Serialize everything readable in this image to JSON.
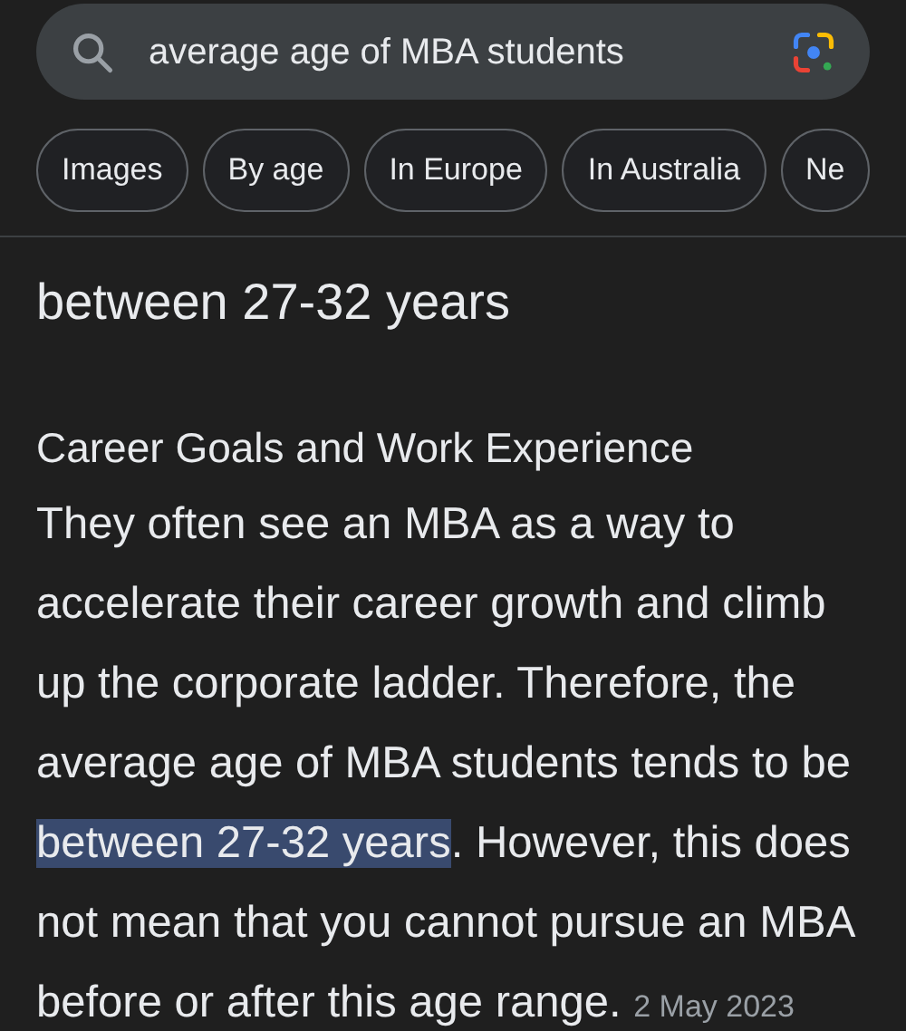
{
  "search": {
    "value": "average age of MBA students"
  },
  "chips": [
    {
      "label": "Images"
    },
    {
      "label": "By age"
    },
    {
      "label": "In Europe"
    },
    {
      "label": "In Australia"
    },
    {
      "label": "Ne"
    }
  ],
  "answer": "between 27-32 years",
  "section_heading": "Career Goals and Work Experience",
  "snippet": "They often see an MBA as a way to accelerate their career growth and climb up the corporate ladder. Therefore, the average age of MBA students tends to be **between 27-32 years**. However, this does not mean that you cannot pursue an MBA before or after this age range.",
  "date": "2 May 2023"
}
